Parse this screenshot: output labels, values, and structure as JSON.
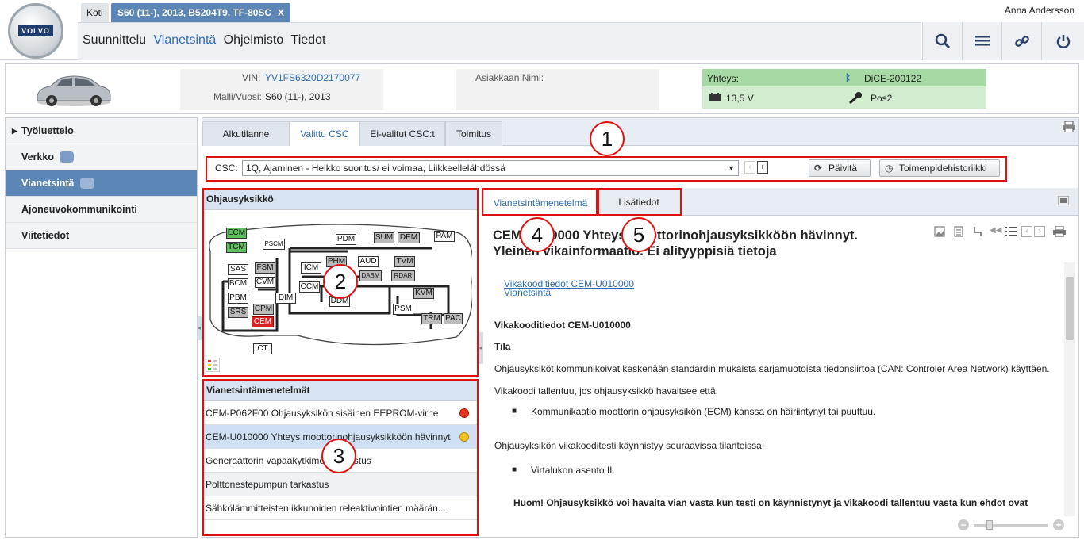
{
  "header": {
    "home_tab": "Koti",
    "vehicle_tab": "S60 (11-), 2013, B5204T9, TF-80SC",
    "vehicle_tab_close": "X",
    "user": "Anna Andersson",
    "logo": "VOLVO",
    "nav": [
      "Suunnittelu",
      "Vianetsintä",
      "Ohjelmisto",
      "Tiedot"
    ],
    "active_nav": "Vianetsintä"
  },
  "toolbar_icons": [
    "search-icon",
    "menu-icon",
    "link-icon",
    "power-icon"
  ],
  "vehicle": {
    "vin_label": "VIN:",
    "vin": "YV1FS6320D2170077",
    "model_label": "Malli/Vuosi:",
    "model": "S60 (11-), 2013",
    "customer_label": "Asiakkaan Nimi:",
    "customer": "",
    "conn_label": "Yhteys:",
    "device": "DiCE-200122",
    "voltage": "13,5 V",
    "key_pos": "Pos2"
  },
  "sidebar": {
    "items": [
      {
        "label": "Työluettelo"
      },
      {
        "label": "Verkko"
      },
      {
        "label": "Vianetsintä"
      },
      {
        "label": "Ajoneuvokommunikointi"
      },
      {
        "label": "Viitetiedot"
      }
    ]
  },
  "tabs": [
    "Alkutilanne",
    "Valittu CSC",
    "Ei-valitut CSC:t",
    "Toimitus"
  ],
  "csc": {
    "label": "CSC:",
    "value": "1Q, Ajaminen - Heikko suoritus/ ei voimaa, Liikkeellelähdössä",
    "refresh": "Päivitä",
    "history": "Toimenpidehistoriikki"
  },
  "ecu_panel": {
    "title": "Ohjausyksikkö",
    "nodes": [
      "ECM",
      "TCM",
      "PSCM",
      "PDM",
      "SUM",
      "DEM",
      "PAM",
      "SAS",
      "FSM",
      "BCM",
      "CVM",
      "ICM",
      "PHM",
      "AUD",
      "TVM",
      "DABM",
      "RDAR",
      "PBM",
      "DIM",
      "CCM",
      "DDM",
      "KVM",
      "SRS",
      "CPM",
      "CEM",
      "PSM",
      "TRM",
      "PAC",
      "CT"
    ]
  },
  "methods": {
    "title": "Vianetsintämenetelmät",
    "items": [
      {
        "label": "CEM-P062F00 Ohjausyksikön sisäinen EEPROM-virhe",
        "status": "red"
      },
      {
        "label": "CEM-U010000 Yhteys moottorinohjausyksikköön hävinnyt",
        "status": "yellow"
      },
      {
        "label": "Generaattorin vapaakytkimen tarkastus",
        "status": ""
      },
      {
        "label": "Polttonestepumpun tarkastus",
        "status": ""
      },
      {
        "label": "Sähkölämmitteisten ikkunoiden releaktivointien määrän...",
        "status": ""
      }
    ]
  },
  "detail": {
    "tabs": [
      "Vianetsintämenetelmä",
      "Lisätiedot"
    ],
    "title": "CEM-U010000 Yhteys moottorinohjausyksikköön hävinnyt. Yleinen vikainformaatio. Ei alityyppisiä tietoja",
    "links": [
      "Vikakooditiedot CEM-U010000",
      "Vianetsintä"
    ],
    "heading": "Vikakooditiedot CEM-U010000",
    "subheading": "Tila",
    "p1": "Ohjausyksiköt kommunikoivat keskenään standardin mukaista sarjamuotoista tiedonsiirtoa (CAN: Controler Area Network) käyttäen.",
    "p2": "Vikakoodi tallentuu, jos ohjausyksikkö havaitsee että:",
    "b1": "Kommunikaatio moottorin ohjausyksikön (ECM) kanssa on häiriintynyt tai puuttuu.",
    "p3": "Ohjausyksikön vikakooditesti käynnistyy seuraavissa tilanteissa:",
    "b2": "Virtalukon asento II.",
    "p4": "Huom! Ohjausyksikkö voi havaita vian vasta kun testi on käynnistynyt ja vikakoodi tallentuu vasta kun ehdot ovat"
  },
  "annotations": [
    "1",
    "2",
    "3",
    "4",
    "5"
  ],
  "colors": {
    "accent": "#5b86b6",
    "link": "#2f6db5",
    "annotation": "#e01010",
    "conn_green": "#a6d9a3",
    "cem_red": "#e02020"
  }
}
